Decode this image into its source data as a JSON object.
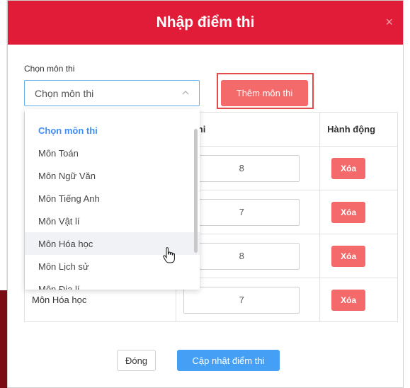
{
  "modal": {
    "title": "Nhập điểm thi",
    "close_icon": "×"
  },
  "form": {
    "subject_label": "Chọn môn thi",
    "select_value": "Chọn môn thi",
    "add_button": "Thêm môn thi"
  },
  "table": {
    "headers": [
      "",
      "m thi",
      "Hành động"
    ],
    "rows": [
      {
        "subject": "",
        "score": "8",
        "action": "Xóa"
      },
      {
        "subject": "",
        "score": "7",
        "action": "Xóa"
      },
      {
        "subject": "",
        "score": "8",
        "action": "Xóa"
      },
      {
        "subject": "Môn Hóa học",
        "score": "7",
        "action": "Xóa"
      }
    ]
  },
  "dropdown": {
    "items": [
      "Chọn môn thi",
      "Môn Toán",
      "Môn Ngữ Văn",
      "Môn Tiếng Anh",
      "Môn Vật lí",
      "Môn Hóa học",
      "Môn Lịch sử",
      "Môn Địa lí"
    ],
    "selected_index": 0,
    "hover_index": 5
  },
  "footer": {
    "close_button": "Đóng",
    "update_button": "Cập nhật điểm thi"
  },
  "colors": {
    "header": "#e01c38",
    "accent_red": "#f46a6a",
    "primary_blue": "#45a0f5",
    "selected_text": "#3e8ef7"
  }
}
